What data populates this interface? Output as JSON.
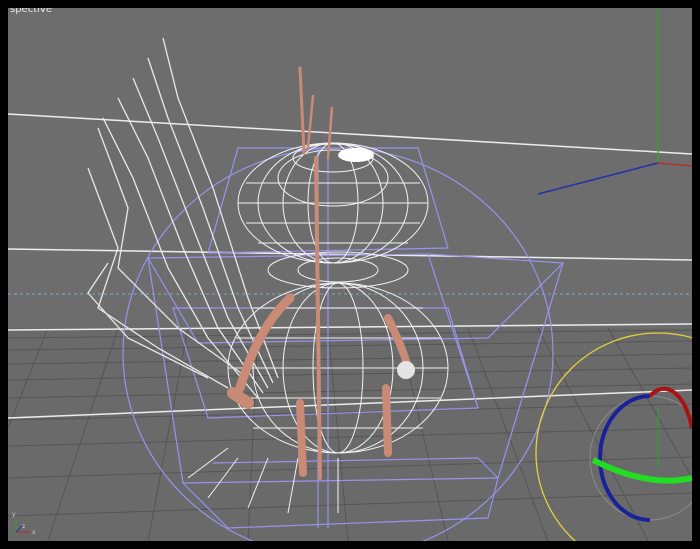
{
  "viewport": {
    "label": "spective",
    "background": "#6d6d6d",
    "wireframe_color": "#f2f2f2",
    "bone_color": "#c98b76",
    "bounding_color": "#9a92ec",
    "axis_colors": {
      "x": "#cc2222",
      "y": "#22aa22",
      "z": "#2233aa"
    }
  },
  "gizmo": {
    "axis_labels": {
      "x": "x",
      "y": "y",
      "z": "z"
    }
  }
}
